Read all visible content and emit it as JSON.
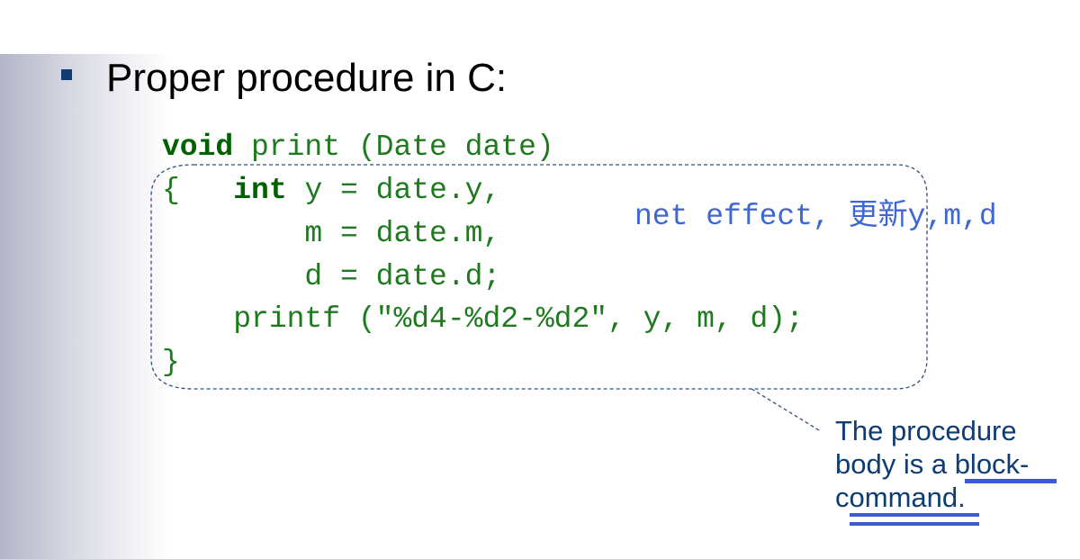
{
  "slide": {
    "heading": "Proper procedure in C:"
  },
  "code": {
    "line1_kw": "void",
    "line1_rest": " print (Date date)",
    "line2_brace": "{   ",
    "line2_kw": "int",
    "line2_rest": " y = date.y,",
    "line3": "        m = date.m,",
    "line4": "        d = date.d;",
    "line5": "    printf (\"%d4-%d2-%d2\", y, m, d);",
    "line6": "}"
  },
  "annotation": {
    "text": "net effect, 更新y,m,d"
  },
  "callout": {
    "line1": "The procedure",
    "line2": "body is a block-",
    "line3": "command."
  },
  "colors": {
    "code": "#1f7a1f",
    "keyword": "#006100",
    "annotation": "#3d66d6",
    "callout": "#0f3c73",
    "bullet": "#0f3c73"
  }
}
